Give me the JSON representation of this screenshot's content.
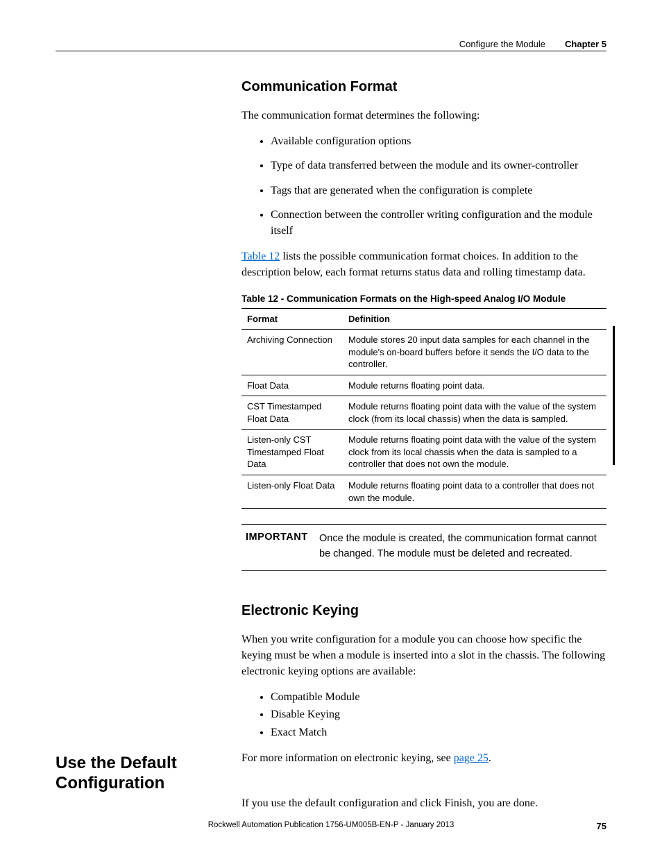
{
  "header": {
    "section": "Configure the Module",
    "chapter": "Chapter 5"
  },
  "comm": {
    "heading": "Communication Format",
    "intro": "The communication format determines the following:",
    "bullets": [
      "Available configuration options",
      "Type of data transferred between the module and its owner-controller",
      "Tags that are generated when the configuration is complete",
      "Connection between the controller writing configuration and the module itself"
    ],
    "table_ref_link": "Table 12",
    "table_ref_rest": " lists the possible communication format choices. In addition to the description below, each format returns status data and rolling timestamp data."
  },
  "table12": {
    "title": "Table 12 - Communication Formats on the High-speed Analog I/O Module",
    "col1": "Format",
    "col2": "Definition",
    "rows": [
      {
        "f": "Archiving Connection",
        "d": "Module stores 20 input data samples for each channel in the module's on-board buffers before it sends the I/O data to the controller."
      },
      {
        "f": "Float Data",
        "d": "Module returns floating point data."
      },
      {
        "f": "CST Timestamped Float Data",
        "d": "Module returns floating point data with the value of the system clock (from its local chassis) when the data is sampled."
      },
      {
        "f": "Listen-only CST Timestamped Float Data",
        "d": "Module returns floating point data with the value of the system clock from its local chassis when the data is sampled to a controller that does not own the module."
      },
      {
        "f": "Listen-only Float Data",
        "d": "Module returns floating point data to a controller that does not own the module."
      }
    ]
  },
  "important": {
    "label": "IMPORTANT",
    "text": "Once the module is created, the communication format cannot be changed. The module must be deleted and recreated."
  },
  "ekey": {
    "heading": "Electronic Keying",
    "intro": "When you write configuration for a module you can choose how specific the keying must be when a module is inserted into a slot in the chassis. The following electronic keying options are available:",
    "bullets": [
      "Compatible Module",
      "Disable Keying",
      "Exact Match"
    ],
    "more_pre": "For more information on electronic keying, see ",
    "more_link": "page 25",
    "more_post": "."
  },
  "defaultcfg": {
    "sidehead": "Use the Default Configuration",
    "body": "If you use the default configuration and click Finish, you are done."
  },
  "footer": {
    "pub": "Rockwell Automation Publication 1756-UM005B-EN-P - January 2013",
    "page": "75"
  }
}
